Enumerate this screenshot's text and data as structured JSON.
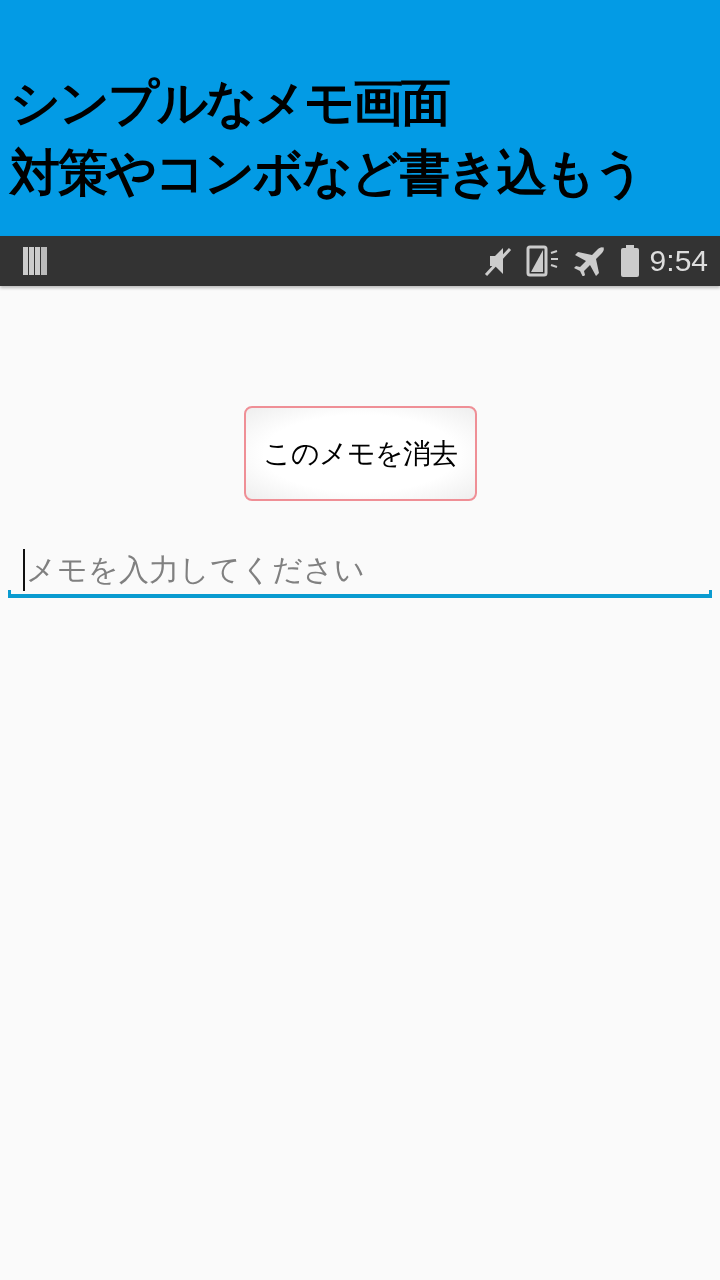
{
  "banner": {
    "lines": [
      "シンプルなメモ画面",
      "対策やコンボなど書き込もう"
    ]
  },
  "status_bar": {
    "time": "9:54"
  },
  "clear_button": {
    "label": "このメモを消去"
  },
  "memo_field": {
    "placeholder": "メモを入力してください",
    "focused": true
  }
}
